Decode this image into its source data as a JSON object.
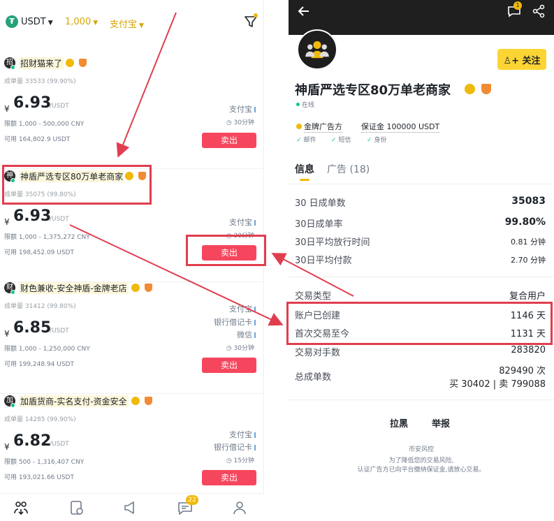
{
  "left": {
    "topbar": {
      "coin": "USDT",
      "amount": "1,000",
      "payment": "支付宝"
    },
    "ads": [
      {
        "avatar_char": "招",
        "name": "招财猫来了",
        "trades": "成单量 33533 (99.90%)",
        "currency": "¥",
        "price": "6.93",
        "unit": "/USDT",
        "limit": "限额 1,000 - 500,000 CNY",
        "available": "可用 164,802.9 USDT",
        "payments": [
          "支付宝"
        ],
        "timer": "30分钟",
        "button": "卖出"
      },
      {
        "avatar_char": "神",
        "name": "神盾严选专区80万单老商家",
        "trades": "成单量 35075 (99.80%)",
        "currency": "¥",
        "price": "6.93",
        "unit": "/USDT",
        "limit": "限额 1,000 - 1,375,272 CNY",
        "available": "可用 198,452.09 USDT",
        "payments": [
          "支付宝"
        ],
        "timer": "30分钟",
        "button": "卖出"
      },
      {
        "avatar_char": "财",
        "name": "财色兼收-安全神盾-金牌老店",
        "trades": "成单量 31412 (99.80%)",
        "currency": "¥",
        "price": "6.85",
        "unit": "/USDT",
        "limit": "限额 1,000 - 1,250,000 CNY",
        "available": "可用 199,248.94 USDT",
        "payments": [
          "支付宝",
          "银行借记卡",
          "微信"
        ],
        "timer": "30分钟",
        "button": "卖出"
      },
      {
        "avatar_char": "加",
        "name": "加盾货商-实名支付-资金安全",
        "trades": "成单量 14285 (99.90%)",
        "currency": "¥",
        "price": "6.82",
        "unit": "/USDT",
        "limit": "限额 500 - 1,316,407 CNY",
        "available": "可用 193,021.66 USDT",
        "payments": [
          "支付宝",
          "银行借记卡"
        ],
        "timer": "15分钟",
        "button": "卖出"
      }
    ],
    "nav_badge": "22"
  },
  "right": {
    "msg_badge": "1",
    "follow": "关注",
    "name": "神盾严选专区80万单老商家",
    "online": "在线",
    "tag_gold": "金牌广告方",
    "deposit": "保证金 100000 USDT",
    "verify": [
      "邮件",
      "短信",
      "身份"
    ],
    "tabs": {
      "info": "信息",
      "ads": "广告 (18)"
    },
    "stats": [
      {
        "label": "30 日成单数",
        "value": "35083"
      },
      {
        "label": "30日成单率",
        "value": "99.80%"
      },
      {
        "label": "30日平均放行时间",
        "value": "0.81 分钟"
      },
      {
        "label": "30日平均付款",
        "value": "2.70 分钟"
      }
    ],
    "details": [
      {
        "label": "交易类型",
        "value": "复合用户"
      },
      {
        "label": "账户已创建",
        "value": "1146 天"
      },
      {
        "label": "首次交易至今",
        "value": "1131 天"
      },
      {
        "label": "交易对手数",
        "value": "283820"
      }
    ],
    "total": {
      "label": "总成单数",
      "value": "829490 次",
      "breakdown": "买 30402 | 卖 799088"
    },
    "actions": {
      "block": "拉黑",
      "report": "举报"
    },
    "risk": {
      "title": "币安风控",
      "line1": "为了降低您的交易风险,",
      "line2": "认证广告方已向平台缴纳保证金,请放心交易。"
    }
  },
  "colors": {
    "accent": "#f0b90b",
    "sell": "#f6465d",
    "highlight": "#e03e4f",
    "online": "#0ecb81"
  }
}
